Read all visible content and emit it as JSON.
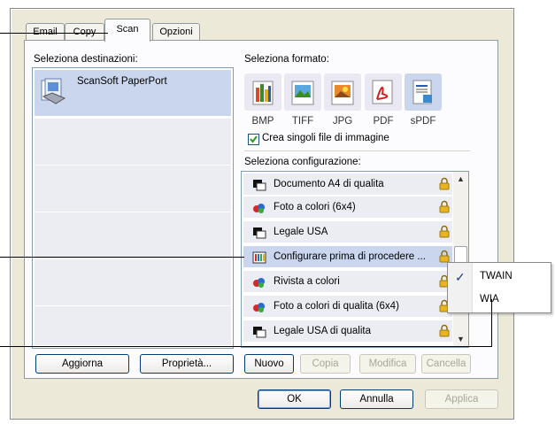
{
  "tabs": [
    {
      "label": "Email",
      "active": false
    },
    {
      "label": "Copy",
      "active": false
    },
    {
      "label": "Scan",
      "active": true
    },
    {
      "label": "Opzioni",
      "active": false
    }
  ],
  "destinations": {
    "label": "Seleziona destinazioni:",
    "items": [
      {
        "label": "ScanSoft PaperPort",
        "icon": "paperport-icon",
        "selected": true
      },
      {
        "label": "",
        "selected": false
      },
      {
        "label": "",
        "selected": false
      },
      {
        "label": "",
        "selected": false
      },
      {
        "label": "",
        "selected": false
      },
      {
        "label": "",
        "selected": false
      }
    ]
  },
  "format": {
    "label": "Seleziona formato:",
    "items": [
      {
        "label": "BMP",
        "icon": "bmp-icon",
        "selected": false
      },
      {
        "label": "TIFF",
        "icon": "tiff-icon",
        "selected": false
      },
      {
        "label": "JPG",
        "icon": "jpg-icon",
        "selected": false
      },
      {
        "label": "PDF",
        "icon": "pdf-icon",
        "selected": false
      },
      {
        "label": "sPDF",
        "icon": "spdf-icon",
        "selected": true
      }
    ],
    "single_files_label": "Crea singoli file di immagine",
    "single_files_checked": true
  },
  "config": {
    "label": "Seleziona configurazione:",
    "items": [
      {
        "label": "Documento A4 di qualita",
        "icon": "bw-scan-icon",
        "locked": true
      },
      {
        "label": "Foto a colori (6x4)",
        "icon": "color-scan-icon",
        "locked": true
      },
      {
        "label": "Legale USA",
        "icon": "bw-scan-icon",
        "locked": true
      },
      {
        "label": "Configurare prima di procedere ...",
        "icon": "configure-icon",
        "locked": true,
        "selected": true
      },
      {
        "label": "Rivista a colori",
        "icon": "color-scan-icon",
        "locked": true
      },
      {
        "label": "Foto a colori di qualita (6x4)",
        "icon": "color-scan-icon",
        "locked": true
      },
      {
        "label": "Legale USA di qualita",
        "icon": "bw-scan-icon",
        "locked": true
      }
    ]
  },
  "popup_menu": {
    "items": [
      {
        "label": "TWAIN",
        "checked": true
      },
      {
        "label": "WIA",
        "checked": false
      }
    ]
  },
  "buttons": {
    "refresh": "Aggiorna",
    "properties": "Proprietà...",
    "new": "Nuovo",
    "copy": "Copia",
    "edit": "Modifica",
    "delete": "Cancella",
    "ok": "OK",
    "cancel": "Annulla",
    "apply": "Applica"
  },
  "colors": {
    "selection": "#c9d6ee",
    "row": "#ecedf3",
    "dialog_bg": "#ece9d8",
    "lock": "#e8b520"
  }
}
